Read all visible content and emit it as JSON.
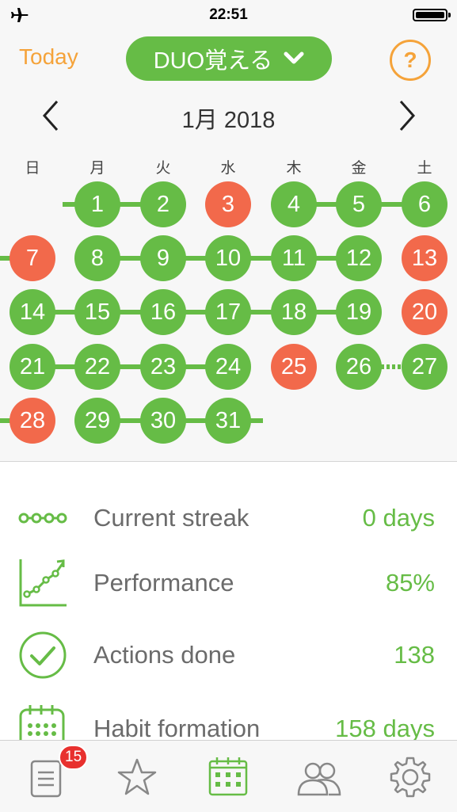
{
  "status_bar": {
    "time": "22:51"
  },
  "header": {
    "today_label": "Today",
    "habit_name": "DUO覚える",
    "help_label": "?"
  },
  "calendar": {
    "month_title": "1月 2018",
    "weekdays": [
      "日",
      "月",
      "火",
      "水",
      "木",
      "金",
      "土"
    ],
    "days": [
      {
        "n": "1",
        "s": "done"
      },
      {
        "n": "2",
        "s": "done"
      },
      {
        "n": "3",
        "s": "missed"
      },
      {
        "n": "4",
        "s": "done"
      },
      {
        "n": "5",
        "s": "done"
      },
      {
        "n": "6",
        "s": "done"
      },
      {
        "n": "7",
        "s": "missed"
      },
      {
        "n": "8",
        "s": "done"
      },
      {
        "n": "9",
        "s": "done"
      },
      {
        "n": "10",
        "s": "done"
      },
      {
        "n": "11",
        "s": "done"
      },
      {
        "n": "12",
        "s": "done"
      },
      {
        "n": "13",
        "s": "missed"
      },
      {
        "n": "14",
        "s": "done"
      },
      {
        "n": "15",
        "s": "done"
      },
      {
        "n": "16",
        "s": "done"
      },
      {
        "n": "17",
        "s": "done"
      },
      {
        "n": "18",
        "s": "done"
      },
      {
        "n": "19",
        "s": "done"
      },
      {
        "n": "20",
        "s": "missed"
      },
      {
        "n": "21",
        "s": "done"
      },
      {
        "n": "22",
        "s": "done"
      },
      {
        "n": "23",
        "s": "done"
      },
      {
        "n": "24",
        "s": "done"
      },
      {
        "n": "25",
        "s": "missed"
      },
      {
        "n": "26",
        "s": "done"
      },
      {
        "n": "27",
        "s": "done"
      },
      {
        "n": "28",
        "s": "missed"
      },
      {
        "n": "29",
        "s": "done"
      },
      {
        "n": "30",
        "s": "done"
      },
      {
        "n": "31",
        "s": "done"
      }
    ],
    "first_weekday_index": 1
  },
  "stats": [
    {
      "icon": "streak-icon",
      "label": "Current streak",
      "value": "0 days"
    },
    {
      "icon": "performance-chart-icon",
      "label": "Performance",
      "value": "85%"
    },
    {
      "icon": "checkmark-circle-icon",
      "label": "Actions done",
      "value": "138"
    },
    {
      "icon": "calendar-grid-icon",
      "label": "Habit formation",
      "value": "158 days"
    }
  ],
  "tabbar": {
    "badge_count": "15",
    "tabs": [
      "notes-tab",
      "favorites-tab",
      "calendar-tab",
      "community-tab",
      "settings-tab"
    ],
    "active_tab": "calendar-tab"
  },
  "colors": {
    "accent_green": "#66bc46",
    "missed_red": "#f2694b",
    "orange": "#f5a33a",
    "badge_red": "#e8302e"
  }
}
